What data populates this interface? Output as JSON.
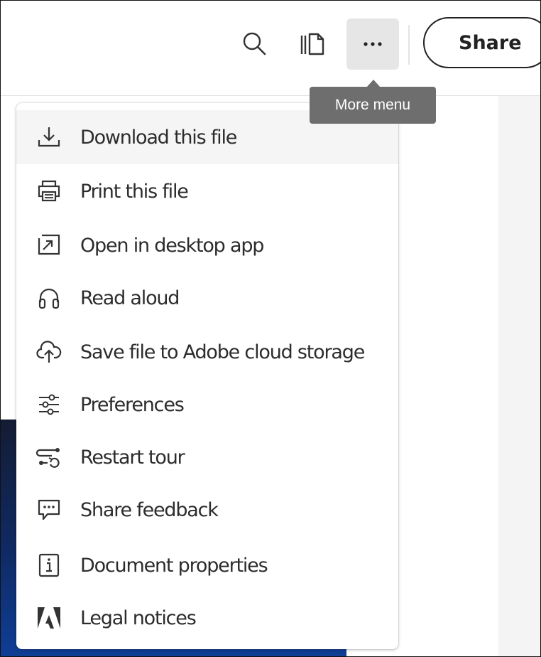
{
  "toolbar": {
    "search_icon": "search-icon",
    "panel_icon": "panel-view-icon",
    "more_icon": "more-ellipsis-icon",
    "share_label": "Share",
    "tooltip": "More menu"
  },
  "menu": {
    "items": [
      {
        "label": "Download this file",
        "icon": "download-icon"
      },
      {
        "label": "Print this file",
        "icon": "printer-icon"
      },
      {
        "label": "Open in desktop app",
        "icon": "open-external-icon"
      },
      {
        "label": "Read aloud",
        "icon": "headphones-icon"
      },
      {
        "label": "Save file to Adobe cloud storage",
        "icon": "cloud-upload-icon"
      },
      {
        "label": "Preferences",
        "icon": "sliders-icon"
      },
      {
        "label": "Restart tour",
        "icon": "restart-tour-icon"
      },
      {
        "label": "Share feedback",
        "icon": "feedback-icon"
      },
      {
        "label": "Document properties",
        "icon": "info-icon"
      },
      {
        "label": "Legal notices",
        "icon": "adobe-logo-icon"
      }
    ]
  },
  "colors": {
    "menu_highlight": "#f5f5f5",
    "tooltip_bg": "#6e6e6e",
    "more_button_bg": "#e6e6e6",
    "doc_thumbnail": "#0f3e96"
  }
}
